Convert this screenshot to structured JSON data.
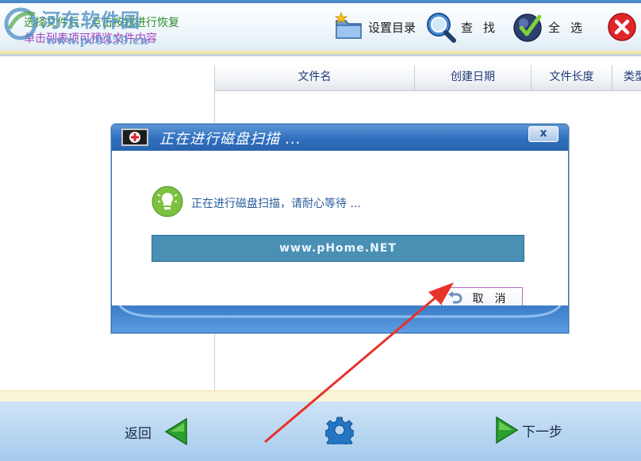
{
  "toolbar": {
    "hint_line1": "选择文件后，点击按钮进行恢复",
    "hint_line2": "单击列表项可预览文件内容",
    "set_dir_label": "设置目录",
    "find_label": "查找",
    "select_all_label": "全选",
    "icons": [
      "folder-settings-icon",
      "search-icon",
      "check-icon",
      "close-icon"
    ]
  },
  "watermark": {
    "text": "河东软件园",
    "url": "www.pc0359.cn"
  },
  "file_table": {
    "columns": [
      "文件名",
      "创建日期",
      "文件长度",
      "类型"
    ]
  },
  "dialog": {
    "title": "正在进行磁盘扫描 ...",
    "close_label": "x",
    "message": "正在进行磁盘扫描，请耐心等待 ...",
    "progress_watermark": "www.pHome.NET",
    "cancel_label": "取消"
  },
  "footer": {
    "back_label": "返回",
    "next_label": "下一步",
    "icons": [
      "back-arrow-icon",
      "gear-icon",
      "next-arrow-icon"
    ]
  },
  "colors": {
    "title_bar": "#2f6fbf",
    "progress_fill": "#4a90b4",
    "footer": "#b8d6f1",
    "annotation_arrow": "#e8322a"
  }
}
